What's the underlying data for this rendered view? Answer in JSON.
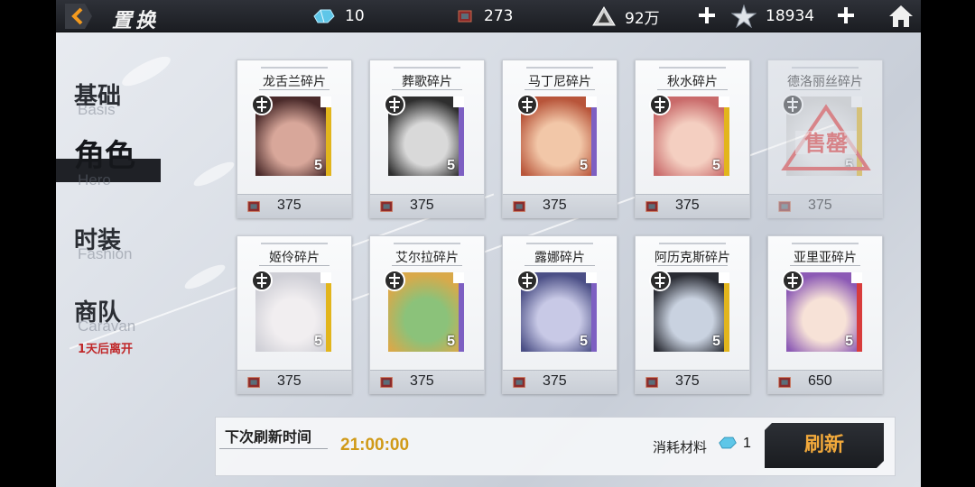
{
  "topbar": {
    "title": "置换",
    "crystal": "10",
    "book": "273",
    "gold": "92万",
    "stamina": "18934"
  },
  "sidebar": {
    "items": [
      {
        "zh": "基础",
        "en": "Basis"
      },
      {
        "zh": "角色",
        "en": "Hero"
      },
      {
        "zh": "时装",
        "en": "Fashion"
      },
      {
        "zh": "商队",
        "en": "Caravan"
      }
    ],
    "caravan_note": "1天后离开"
  },
  "cards": [
    {
      "name": "龙舌兰碎片",
      "stars": "5",
      "price": "375",
      "star_color": "#e2b51c",
      "sold": false
    },
    {
      "name": "葬歌碎片",
      "stars": "5",
      "price": "375",
      "star_color": "#7d5fc2",
      "sold": false
    },
    {
      "name": "马丁尼碎片",
      "stars": "5",
      "price": "375",
      "star_color": "#7d5fc2",
      "sold": false
    },
    {
      "name": "秋水碎片",
      "stars": "5",
      "price": "375",
      "star_color": "#e2b51c",
      "sold": false
    },
    {
      "name": "德洛丽丝碎片",
      "stars": "5",
      "price": "375",
      "star_color": "#e2b51c",
      "sold": true,
      "sold_text": "售罄"
    },
    {
      "name": "姬伶碎片",
      "stars": "5",
      "price": "375",
      "star_color": "#e2b51c",
      "sold": false
    },
    {
      "name": "艾尔拉碎片",
      "stars": "5",
      "price": "375",
      "star_color": "#7d5fc2",
      "sold": false
    },
    {
      "name": "露娜碎片",
      "stars": "5",
      "price": "375",
      "star_color": "#7d5fc2",
      "sold": false
    },
    {
      "name": "阿历克斯碎片",
      "stars": "5",
      "price": "375",
      "star_color": "#e2b51c",
      "sold": false
    },
    {
      "name": "亚里亚碎片",
      "stars": "5",
      "price": "650",
      "star_color": "#d83c3c",
      "sold": false
    }
  ],
  "bottom": {
    "refresh_label": "下次刷新时间",
    "refresh_time": "21:00:00",
    "cost_label": "消耗材料",
    "cost_num": "1",
    "refresh_button": "刷新"
  }
}
